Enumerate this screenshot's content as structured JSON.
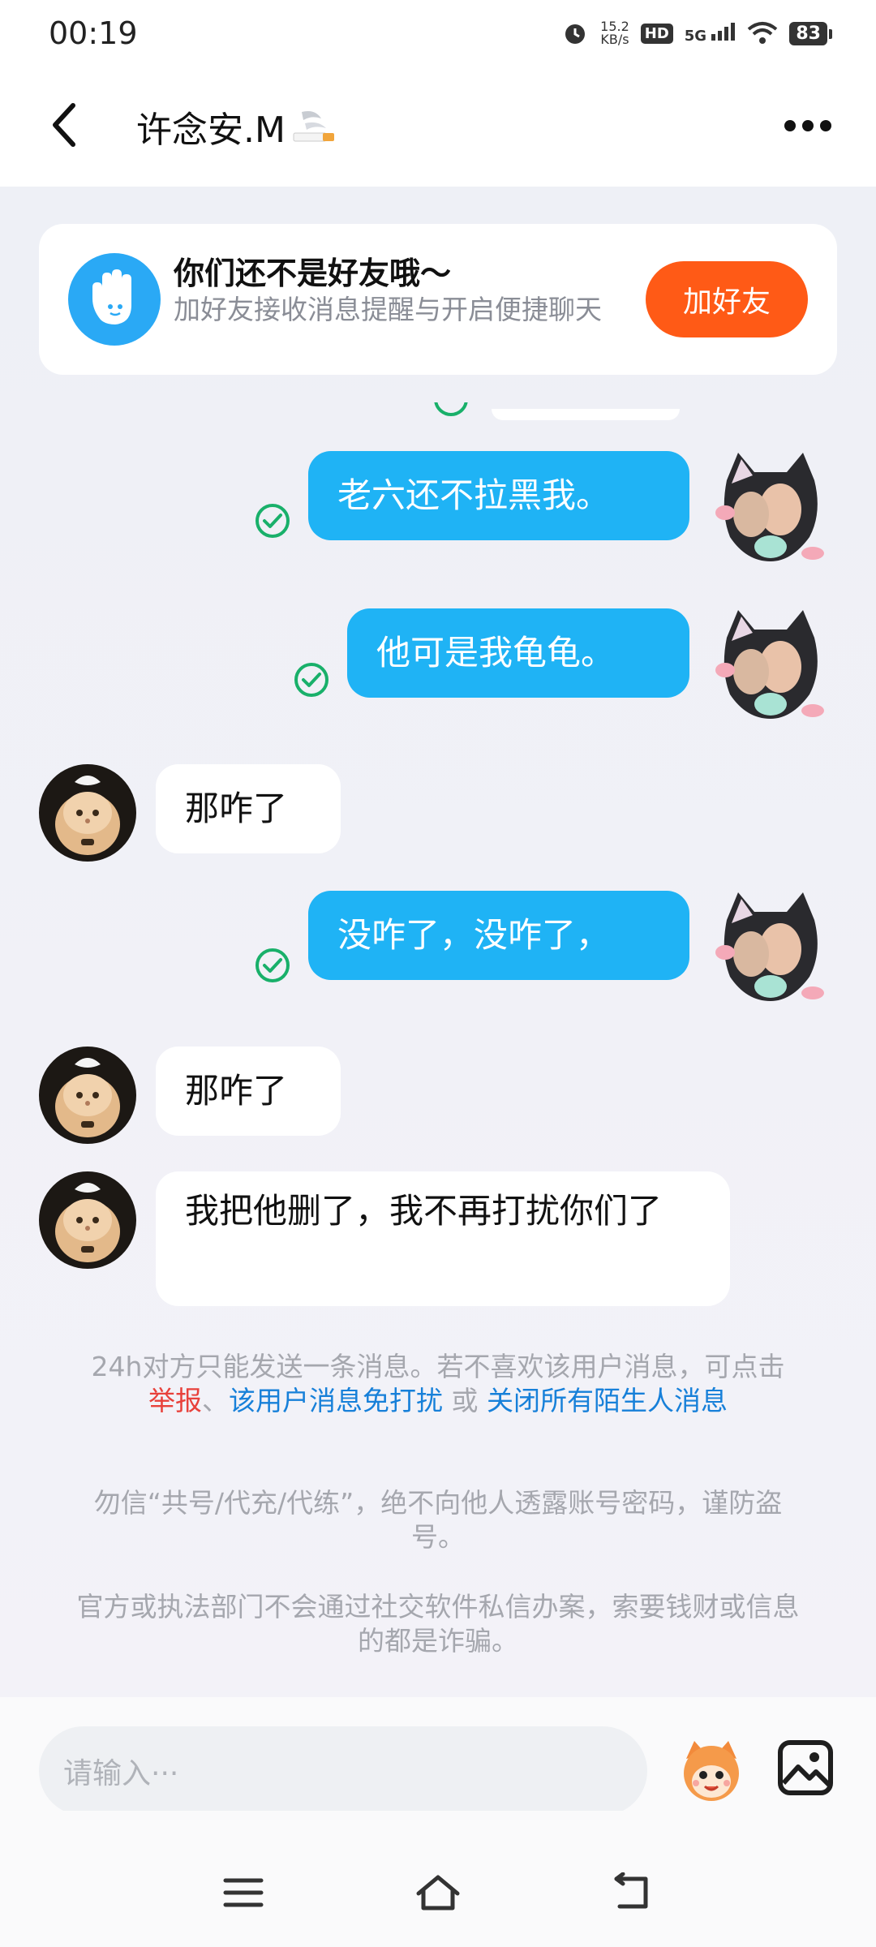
{
  "status_bar": {
    "time": "00:19",
    "net_speed_value": "15.2",
    "net_speed_unit": "KB/s",
    "hd_label": "HD",
    "network": "5G",
    "battery": "83"
  },
  "header": {
    "title": "许念安.M",
    "title_emoji_icon": "cigarette-icon"
  },
  "friend_card": {
    "title": "你们还不是好友哦～",
    "subtitle": "加好友接收消息提醒与开启便捷聊天",
    "button_label": "加好友"
  },
  "messages": [
    {
      "from": "me",
      "text": "老六还不拉黑我。",
      "status": "sent-check-icon"
    },
    {
      "from": "me",
      "text": "他可是我龟龟。",
      "status": "sent-check-icon"
    },
    {
      "from": "them",
      "text": "那咋了"
    },
    {
      "from": "me",
      "text": "没咋了，没咋了，",
      "status": "sent-check-icon"
    },
    {
      "from": "them",
      "text": "那咋了"
    },
    {
      "from": "them",
      "text": "我把他删了，我不再打扰你们了"
    }
  ],
  "notice": {
    "line1": "24h对方只能发送一条消息。若不喜欢该用户消息，可点击",
    "report": "举报",
    "sep1": "、",
    "mute": "该用户消息免打扰",
    "or": " 或 ",
    "close_all": "关闭所有陌生人消息"
  },
  "warnings": {
    "w1": "勿信“共号/代充/代练”，绝不向他人透露账号密码，谨防盗号。",
    "w2": "官方或执法部门不会通过社交软件私信办案，索要钱财或信息的都是诈骗。"
  },
  "input": {
    "placeholder": "请输入···"
  },
  "colors": {
    "my_bubble": "#1fb3f5",
    "add_button": "#ff5a16",
    "check_green": "#19b06a",
    "link_red": "#e8413b",
    "link_blue": "#1780d9"
  }
}
